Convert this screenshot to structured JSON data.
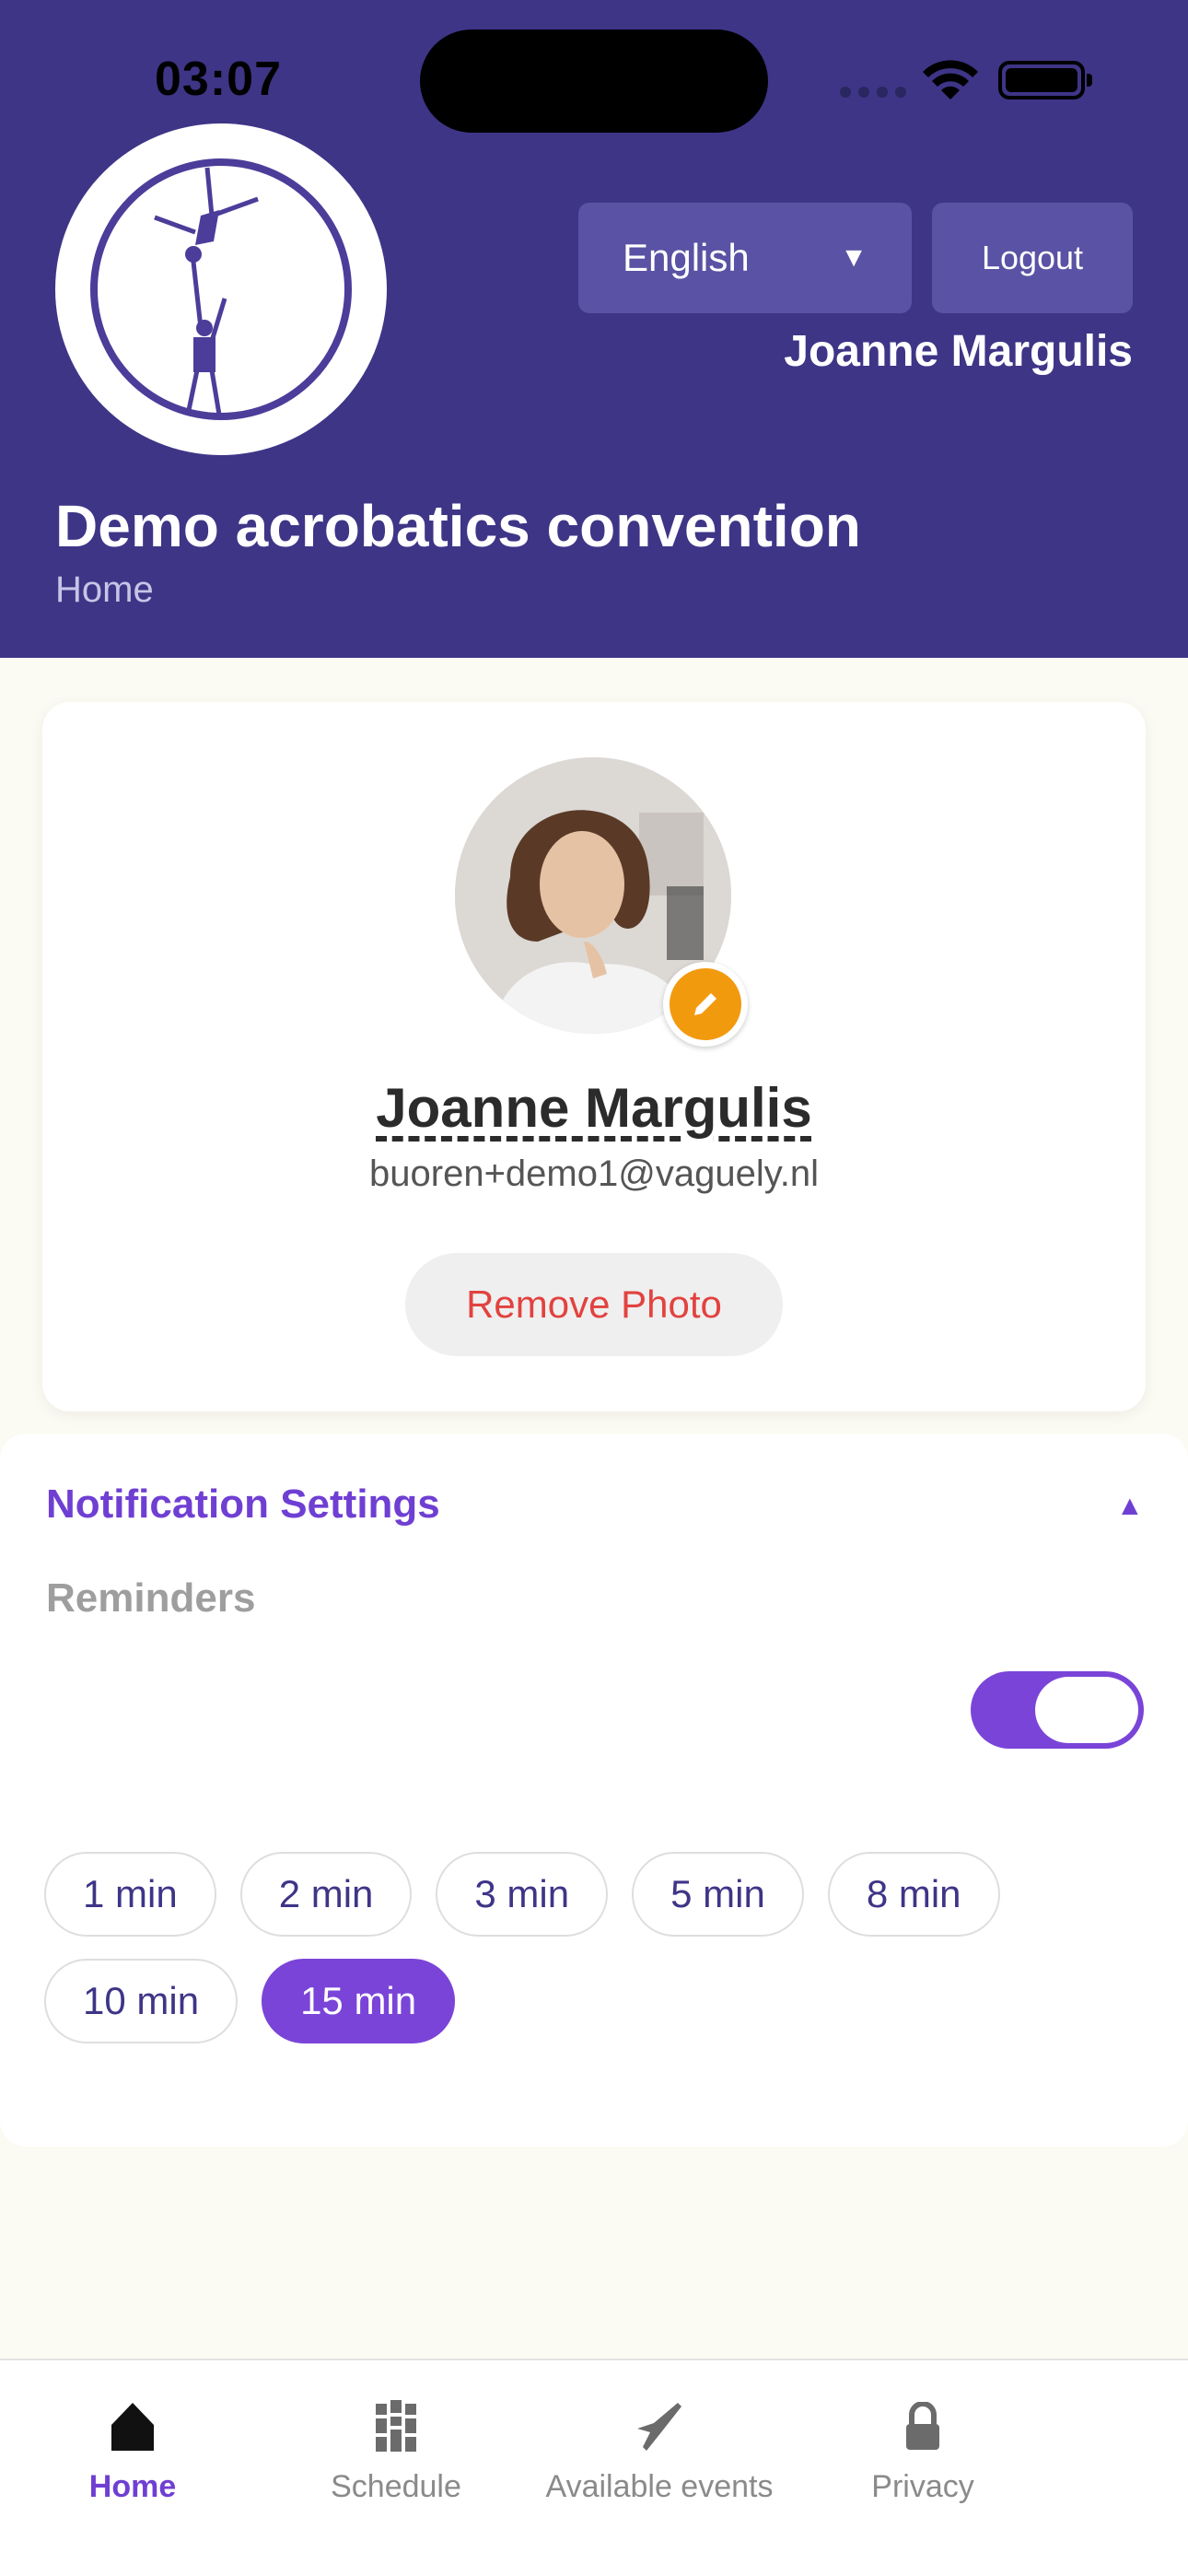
{
  "status_bar": {
    "time": "03:07"
  },
  "header": {
    "language": {
      "selected": "English"
    },
    "logout_label": "Logout",
    "user_name": "Joanne Margulis",
    "event_title": "Demo acrobatics convention",
    "breadcrumb": "Home"
  },
  "profile": {
    "name": "Joanne Margulis",
    "email": "buoren+demo1@vaguely.nl",
    "remove_photo_label": "Remove Photo"
  },
  "notifications": {
    "title": "Notification Settings",
    "reminders_label": "Reminders",
    "reminders_enabled": true,
    "options": [
      "1 min",
      "2 min",
      "3 min",
      "5 min",
      "8 min",
      "10 min",
      "15 min"
    ],
    "selected": "15 min"
  },
  "tabs": [
    {
      "label": "Home",
      "icon": "home-icon",
      "active": true
    },
    {
      "label": "Schedule",
      "icon": "schedule-icon",
      "active": false
    },
    {
      "label": "Available events",
      "icon": "events-icon",
      "active": false
    },
    {
      "label": "Privacy",
      "icon": "lock-icon",
      "active": false
    }
  ],
  "colors": {
    "header": "#3e3587",
    "accent": "#7a44d8",
    "badge": "#f29a0e",
    "danger": "#e2423f"
  }
}
